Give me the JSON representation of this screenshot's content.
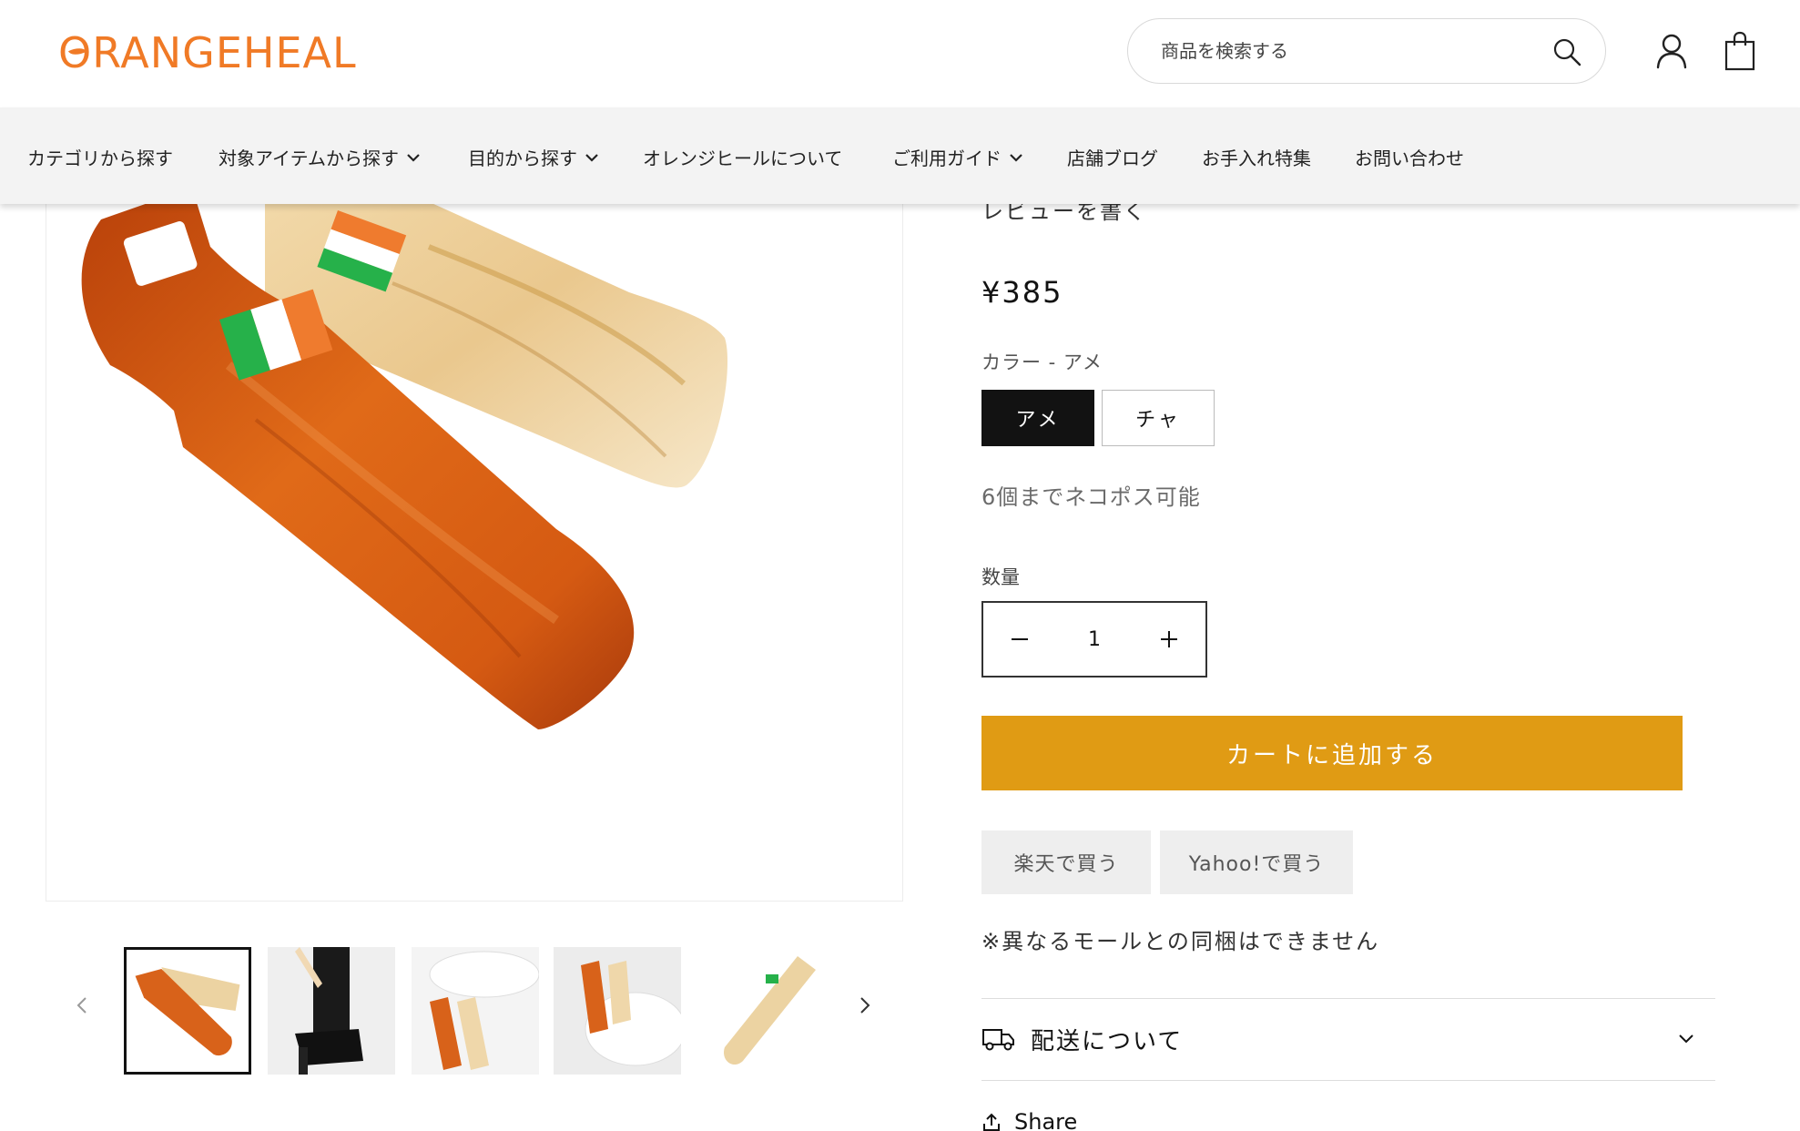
{
  "header": {
    "logo_text": "ORANGEHEAL",
    "logo_color": "#f07a26",
    "search_placeholder": "商品を検索する"
  },
  "nav": {
    "items": [
      {
        "label": "カテゴリから探す",
        "dropdown": false
      },
      {
        "label": "対象アイテムから探す",
        "dropdown": true
      },
      {
        "label": "目的から探す",
        "dropdown": true
      },
      {
        "label": "オレンジヒールについて",
        "dropdown": false
      },
      {
        "label": "ご利用ガイド",
        "dropdown": true
      },
      {
        "label": "店舗ブログ",
        "dropdown": false
      },
      {
        "label": "お手入れ特集",
        "dropdown": false
      },
      {
        "label": "お問い合わせ",
        "dropdown": false
      }
    ]
  },
  "product": {
    "review_link": "レビューを書く",
    "price": "¥385",
    "color_label": "カラー - アメ",
    "variants": [
      {
        "label": "アメ",
        "selected": true
      },
      {
        "label": "チャ",
        "selected": false
      }
    ],
    "shipping_note": "6個までネコポス可能",
    "quantity_label": "数量",
    "quantity": "1",
    "add_to_cart": "カートに追加する",
    "add_to_cart_color": "#e09b14",
    "rakuten_button": "楽天で買う",
    "yahoo_button": "Yahoo!で買う",
    "mall_note": "※異なるモールとの同梱はできません",
    "shipping_accordion": "配送について",
    "share": "Share"
  },
  "gallery": {
    "thumb_count": 5,
    "active_thumb": 1
  }
}
